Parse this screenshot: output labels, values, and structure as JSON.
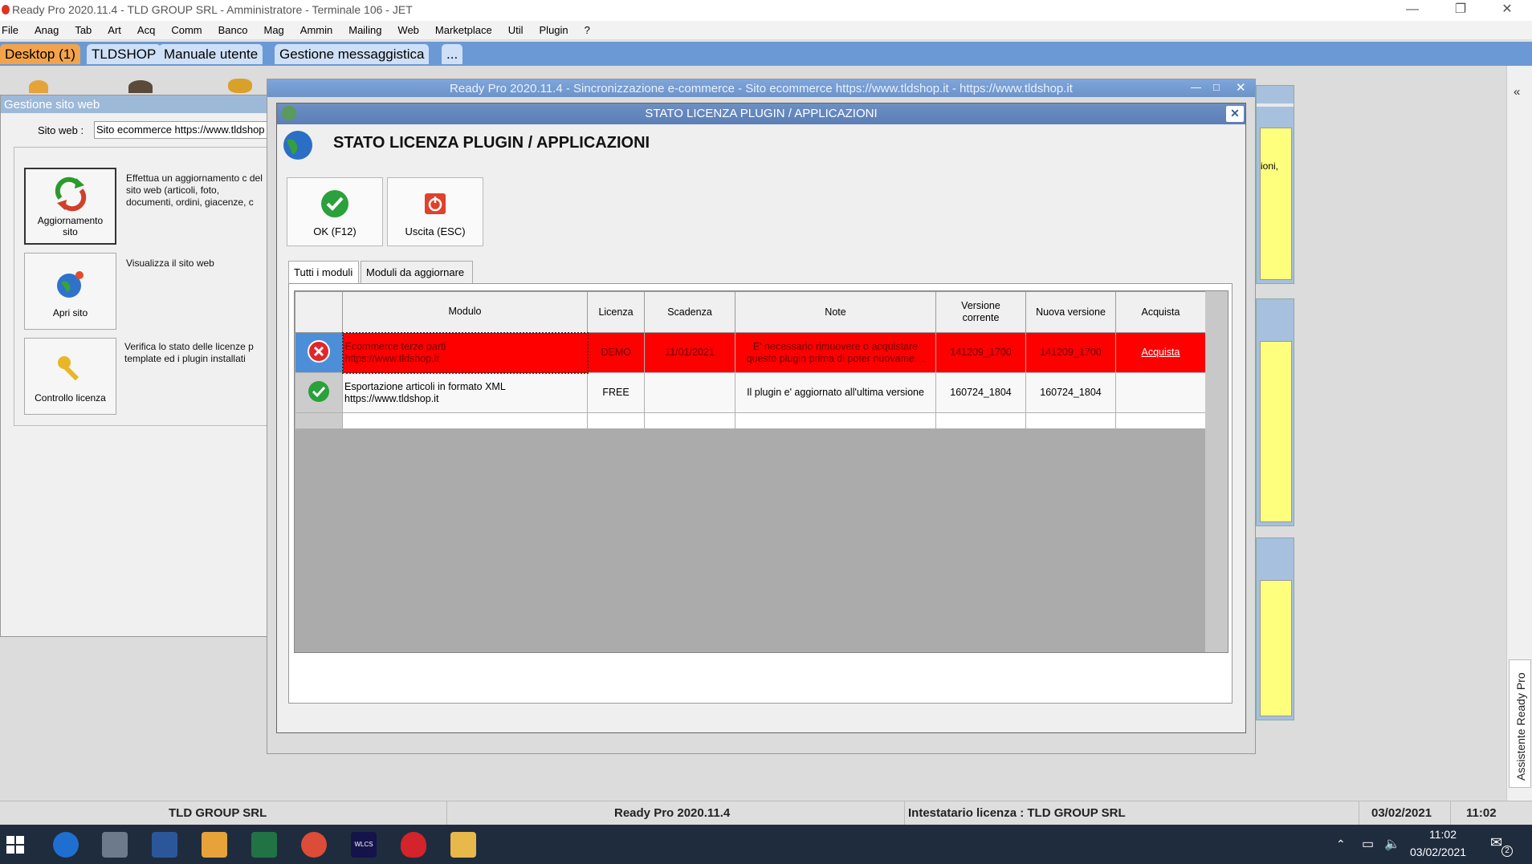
{
  "window": {
    "title": "Ready Pro 2020.11.4 - TLD GROUP SRL - Amministratore - Terminale 106 - JET"
  },
  "menu": [
    "File",
    "Anag",
    "Tab",
    "Art",
    "Acq",
    "Comm",
    "Banco",
    "Mag",
    "Ammin",
    "Mailing",
    "Web",
    "Marketplace",
    "Util",
    "Plugin",
    "?"
  ],
  "tabs": [
    "Desktop (1)",
    "TLDSHOP",
    "Manuale utente",
    "Gestione messaggistica",
    "..."
  ],
  "left_panel": {
    "title": "Gestione sito web",
    "site_label": "Sito web :",
    "site_value": "Sito ecommerce https://www.tldshop",
    "buttons": [
      {
        "label": "Aggiornamento sito",
        "desc": "Effettua un aggiornamento c del sito web (articoli, foto, documenti, ordini, giacenze, c"
      },
      {
        "label": "Apri sito",
        "desc": "Visualizza il sito web"
      },
      {
        "label": "Controllo licenza",
        "desc": "Verifica lo stato delle licenze p template ed i plugin installati"
      }
    ]
  },
  "bg_window": {
    "title": "Ready Pro 2020.11.4 - Sincronizzazione e-commerce - Sito ecommerce https://www.tldshop.it - https://www.tldshop.it",
    "right_note": "ioni,"
  },
  "dialog": {
    "caption": "STATO LICENZA PLUGIN / APPLICAZIONI",
    "title": "STATO LICENZA PLUGIN / APPLICAZIONI",
    "ok_label": "OK (F12)",
    "exit_label": "Uscita (ESC)",
    "tabs": [
      "Tutti i moduli",
      "Moduli da aggiornare"
    ],
    "columns": [
      "Modulo",
      "Licenza",
      "Scadenza",
      "Note",
      "Versione corrente",
      "Nuova versione",
      "Acquista"
    ],
    "rows": [
      {
        "status": "error",
        "modulo1": "Ecommerce terze parti",
        "modulo2": "https://www.tldshop.it",
        "licenza": "DEMO",
        "scadenza": "11/01/2021",
        "note1": "E' necessario rimuovere o acquistare",
        "note2": "questo plugin prima di poter nuovame…",
        "versione": "141209_1700",
        "nuova": "141209_1700",
        "acquista": "Acquista"
      },
      {
        "status": "ok",
        "modulo1": "Esportazione articoli in formato XML",
        "modulo2": "https://www.tldshop.it",
        "licenza": "FREE",
        "scadenza": "",
        "note1": "Il plugin e' aggiornato all'ultima versione",
        "note2": "",
        "versione": "160724_1804",
        "nuova": "160724_1804",
        "acquista": ""
      }
    ]
  },
  "statusbar": {
    "company": "TLD GROUP SRL",
    "version": "Ready Pro 2020.11.4",
    "license": "Intestatario licenza : TLD GROUP SRL",
    "date": "03/02/2021",
    "time": "11:02"
  },
  "sidebar": {
    "label": "Assistente Ready Pro"
  },
  "taskbar": {
    "time": "11:02",
    "date": "03/02/2021",
    "notif": "2",
    "wlcs": "WLCS"
  },
  "colors": {
    "accent": "#6a99d5",
    "active_tab": "#f3a34a",
    "error_row": "#ff0000"
  }
}
